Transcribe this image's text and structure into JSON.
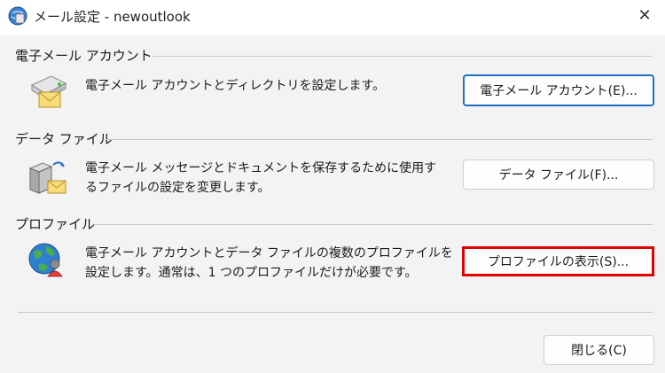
{
  "window": {
    "title": "メール設定 - newoutlook",
    "close_symbol": "✕"
  },
  "email_accounts": {
    "label": "電子メール アカウント",
    "description": "電子メール アカウントとディレクトリを設定します。",
    "button": "電子メール アカウント(E)..."
  },
  "data_files": {
    "label": "データ ファイル",
    "description_line1": "電子メール メッセージとドキュメントを保存するために使用す",
    "description_line2": "るファイルの設定を変更します。",
    "button": "データ ファイル(F)..."
  },
  "profiles": {
    "label": "プロファイル",
    "description_line1": "電子メール アカウントとデータ ファイルの複数のプロファイルを",
    "description_line2": "設定します。通常は、1 つのプロファイルだけが必要です。",
    "button": "プロファイルの表示(S)..."
  },
  "footer": {
    "close_button": "閉じる(C)"
  },
  "colors": {
    "accent": "#1f6fc7",
    "highlight": "#e00000"
  }
}
